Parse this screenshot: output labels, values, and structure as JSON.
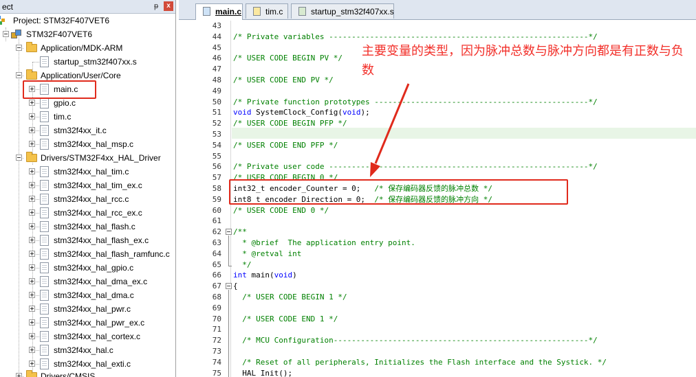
{
  "project_pane": {
    "title": "ect",
    "pin_glyph": "ᵽ",
    "close_glyph": "x",
    "tree": [
      {
        "label": "Project: STM32F407VET6",
        "icon": "project-icon"
      },
      {
        "label": "STM32F407VET6",
        "icon": "target-icon"
      },
      {
        "label": "Application/MDK-ARM",
        "icon": "folder-icon"
      },
      {
        "label": "startup_stm32f407xx.s",
        "icon": "file-icon"
      },
      {
        "label": "Application/User/Core",
        "icon": "folder-icon"
      },
      {
        "label": "main.c",
        "icon": "file-icon"
      },
      {
        "label": "gpio.c",
        "icon": "file-icon"
      },
      {
        "label": "tim.c",
        "icon": "file-icon"
      },
      {
        "label": "stm32f4xx_it.c",
        "icon": "file-icon"
      },
      {
        "label": "stm32f4xx_hal_msp.c",
        "icon": "file-icon"
      },
      {
        "label": "Drivers/STM32F4xx_HAL_Driver",
        "icon": "folder-icon"
      },
      {
        "label": "stm32f4xx_hal_tim.c",
        "icon": "file-icon"
      },
      {
        "label": "stm32f4xx_hal_tim_ex.c",
        "icon": "file-icon"
      },
      {
        "label": "stm32f4xx_hal_rcc.c",
        "icon": "file-icon"
      },
      {
        "label": "stm32f4xx_hal_rcc_ex.c",
        "icon": "file-icon"
      },
      {
        "label": "stm32f4xx_hal_flash.c",
        "icon": "file-icon"
      },
      {
        "label": "stm32f4xx_hal_flash_ex.c",
        "icon": "file-icon"
      },
      {
        "label": "stm32f4xx_hal_flash_ramfunc.c",
        "icon": "file-icon"
      },
      {
        "label": "stm32f4xx_hal_gpio.c",
        "icon": "file-icon"
      },
      {
        "label": "stm32f4xx_hal_dma_ex.c",
        "icon": "file-icon"
      },
      {
        "label": "stm32f4xx_hal_dma.c",
        "icon": "file-icon"
      },
      {
        "label": "stm32f4xx_hal_pwr.c",
        "icon": "file-icon"
      },
      {
        "label": "stm32f4xx_hal_pwr_ex.c",
        "icon": "file-icon"
      },
      {
        "label": "stm32f4xx_hal_cortex.c",
        "icon": "file-icon"
      },
      {
        "label": "stm32f4xx_hal.c",
        "icon": "file-icon"
      },
      {
        "label": "stm32f4xx_hal_exti.c",
        "icon": "file-icon"
      },
      {
        "label": "Drivers/CMSIS",
        "icon": "folder-icon"
      }
    ]
  },
  "editor": {
    "tabs": [
      {
        "label": "main.c",
        "active": true
      },
      {
        "label": "tim.c",
        "active": false
      },
      {
        "label": "startup_stm32f407xx.s",
        "active": false
      }
    ],
    "line_numbers": [
      "43",
      "44",
      "45",
      "46",
      "47",
      "48",
      "49",
      "50",
      "51",
      "52",
      "53",
      "54",
      "55",
      "56",
      "57",
      "58",
      "59",
      "60",
      "61",
      "62",
      "63",
      "64",
      "65",
      "66",
      "67",
      "68",
      "69",
      "70",
      "71",
      "72",
      "73",
      "74",
      "75"
    ],
    "code": {
      "l43": "",
      "l44": "/* Private variables ---------------------------------------------------------*/",
      "l45": "",
      "l46": "/* USER CODE BEGIN PV */",
      "l47": "",
      "l48": "/* USER CODE END PV */",
      "l49": "",
      "l50": "/* Private function prototypes -----------------------------------------------*/",
      "l51_kw1": "void",
      "l51_mid": " SystemClock_Config(",
      "l51_kw2": "void",
      "l51_end": ");",
      "l52": "/* USER CODE BEGIN PFP */",
      "l53": "",
      "l54": "/* USER CODE END PFP */",
      "l55": "",
      "l56": "/* Private user code ---------------------------------------------------------*/",
      "l57": "/* USER CODE BEGIN 0 */",
      "l58_code": "int32_t encoder_Counter = 0;   ",
      "l58_cm_open": "/* ",
      "l58_cm_text": "保存编码器反馈的脉冲总数",
      "l58_cm_close": " */",
      "l59_code": "int8_t encoder_Direction = 0;  ",
      "l59_cm_open": "/* ",
      "l59_cm_text": "保存编码器反馈的脉冲方向",
      "l59_cm_close": " */",
      "l60": "/* USER CODE END 0 */",
      "l61": "",
      "l62": "/**",
      "l63": "  * @brief  The application entry point.",
      "l64": "  * @retval int",
      "l65": "  */",
      "l66_kw": "int",
      "l66_mid": " main(",
      "l66_kw2": "void",
      "l66_end": ")",
      "l67": "{",
      "l68": "  /* USER CODE BEGIN 1 */",
      "l69": "",
      "l70": "  /* USER CODE END 1 */",
      "l71": "",
      "l72": "  /* MCU Configuration--------------------------------------------------------*/",
      "l73": "",
      "l74": "  /* Reset of all peripherals, Initializes the Flash interface and the Systick. */",
      "l75": "  HAL_Init();"
    }
  },
  "annotation": {
    "text": "主要变量的类型，因为脉冲总数与脉冲方向都是有正数与负数"
  },
  "colors": {
    "highlight": "#e02a1c",
    "comment": "#008000",
    "keyword": "#0000ff",
    "annotation_text": "#f2302a"
  }
}
